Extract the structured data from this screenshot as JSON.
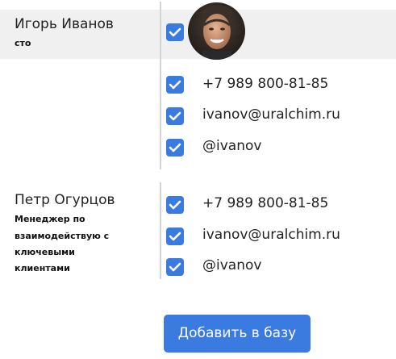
{
  "people": [
    {
      "name": "Игорь Иванов",
      "role": "сто",
      "checked": true,
      "contacts": [
        {
          "type": "phone",
          "value": "+7 989 800-81-85",
          "checked": true
        },
        {
          "type": "email",
          "value": "ivanov@uralchim.ru",
          "checked": true
        },
        {
          "type": "handle",
          "value": "@ivanov",
          "checked": true
        }
      ]
    },
    {
      "name": "Петр Огурцов",
      "role_lines": [
        "Менеджер по",
        "взаимодействую с",
        "ключевыми",
        "клиентами"
      ],
      "contacts": [
        {
          "type": "phone",
          "value": "+7 989 800-81-85",
          "checked": true
        },
        {
          "type": "email",
          "value": "ivanov@uralchim.ru",
          "checked": true
        },
        {
          "type": "handle",
          "value": "@ivanov",
          "checked": true
        }
      ]
    }
  ],
  "actions": {
    "add_label": "Добавить в базу"
  },
  "colors": {
    "accent": "#3b7be0",
    "row_highlight": "#f0f0f0"
  }
}
